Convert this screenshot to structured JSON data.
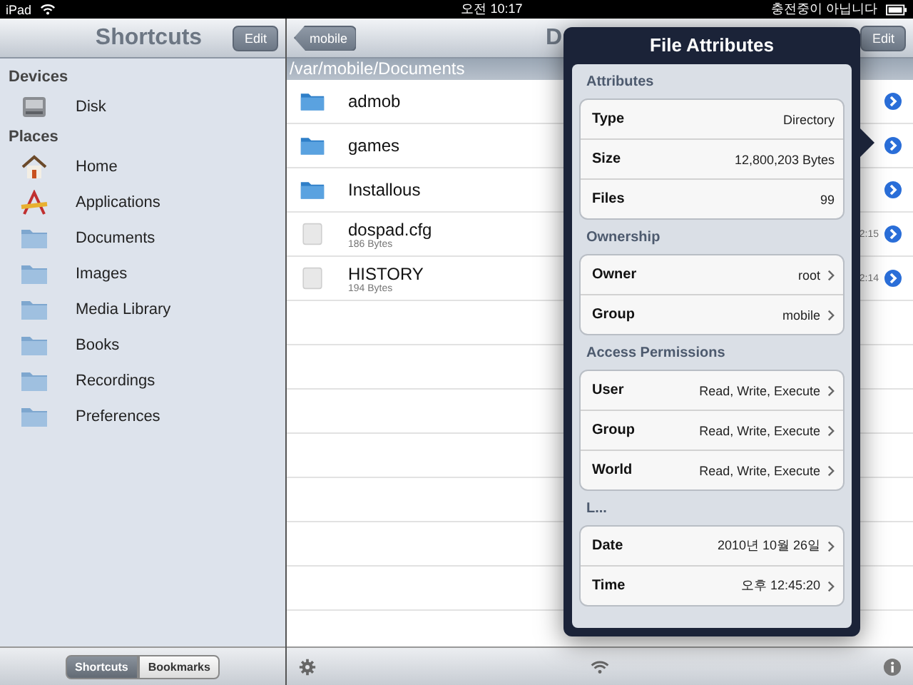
{
  "status_bar": {
    "device": "iPad",
    "time": "오전 10:17",
    "charging": "충전중이 아닙니다"
  },
  "sidebar": {
    "title": "Shortcuts",
    "edit": "Edit",
    "sections": [
      {
        "header": "Devices",
        "items": [
          {
            "label": "Disk",
            "kind": "disk"
          }
        ]
      },
      {
        "header": "Places",
        "items": [
          {
            "label": "Home",
            "kind": "home"
          },
          {
            "label": "Applications",
            "kind": "apps"
          },
          {
            "label": "Documents",
            "kind": "folder"
          },
          {
            "label": "Images",
            "kind": "folder"
          },
          {
            "label": "Media Library",
            "kind": "folder"
          },
          {
            "label": "Books",
            "kind": "folder"
          },
          {
            "label": "Recordings",
            "kind": "folder"
          },
          {
            "label": "Preferences",
            "kind": "folder"
          }
        ]
      }
    ],
    "segments": [
      {
        "label": "Shortcuts",
        "selected": true
      },
      {
        "label": "Bookmarks",
        "selected": false
      }
    ]
  },
  "main": {
    "back": "mobile",
    "title": "D",
    "edit": "Edit",
    "path": "/var/mobile/Documents",
    "rows": [
      {
        "name": "admob",
        "kind": "folder"
      },
      {
        "name": "games",
        "kind": "folder"
      },
      {
        "name": "Installous",
        "kind": "folder"
      },
      {
        "name": "dospad.cfg",
        "kind": "file",
        "size": "186 Bytes",
        "time": "2:15"
      },
      {
        "name": "HISTORY",
        "kind": "file",
        "size": "194 Bytes",
        "time": "2:14"
      }
    ]
  },
  "popover": {
    "title": "File Attributes",
    "sections": [
      {
        "header": "Attributes",
        "rows": [
          {
            "label": "Type",
            "value": "Directory",
            "chevron": false
          },
          {
            "label": "Size",
            "value": "12,800,203 Bytes",
            "chevron": false
          },
          {
            "label": "Files",
            "value": "99",
            "chevron": false
          }
        ]
      },
      {
        "header": "Ownership",
        "rows": [
          {
            "label": "Owner",
            "value": "root",
            "chevron": true
          },
          {
            "label": "Group",
            "value": "mobile",
            "chevron": true
          }
        ]
      },
      {
        "header": "Access Permissions",
        "rows": [
          {
            "label": "User",
            "value": "Read, Write, Execute",
            "chevron": true
          },
          {
            "label": "Group",
            "value": "Read, Write, Execute",
            "chevron": true
          },
          {
            "label": "World",
            "value": "Read, Write, Execute",
            "chevron": true
          }
        ]
      },
      {
        "header": "L...",
        "rows": [
          {
            "label": "Date",
            "value": "2010년 10월 26일",
            "chevron": true
          },
          {
            "label": "Time",
            "value": "오후 12:45:20",
            "chevron": true
          }
        ]
      }
    ]
  }
}
